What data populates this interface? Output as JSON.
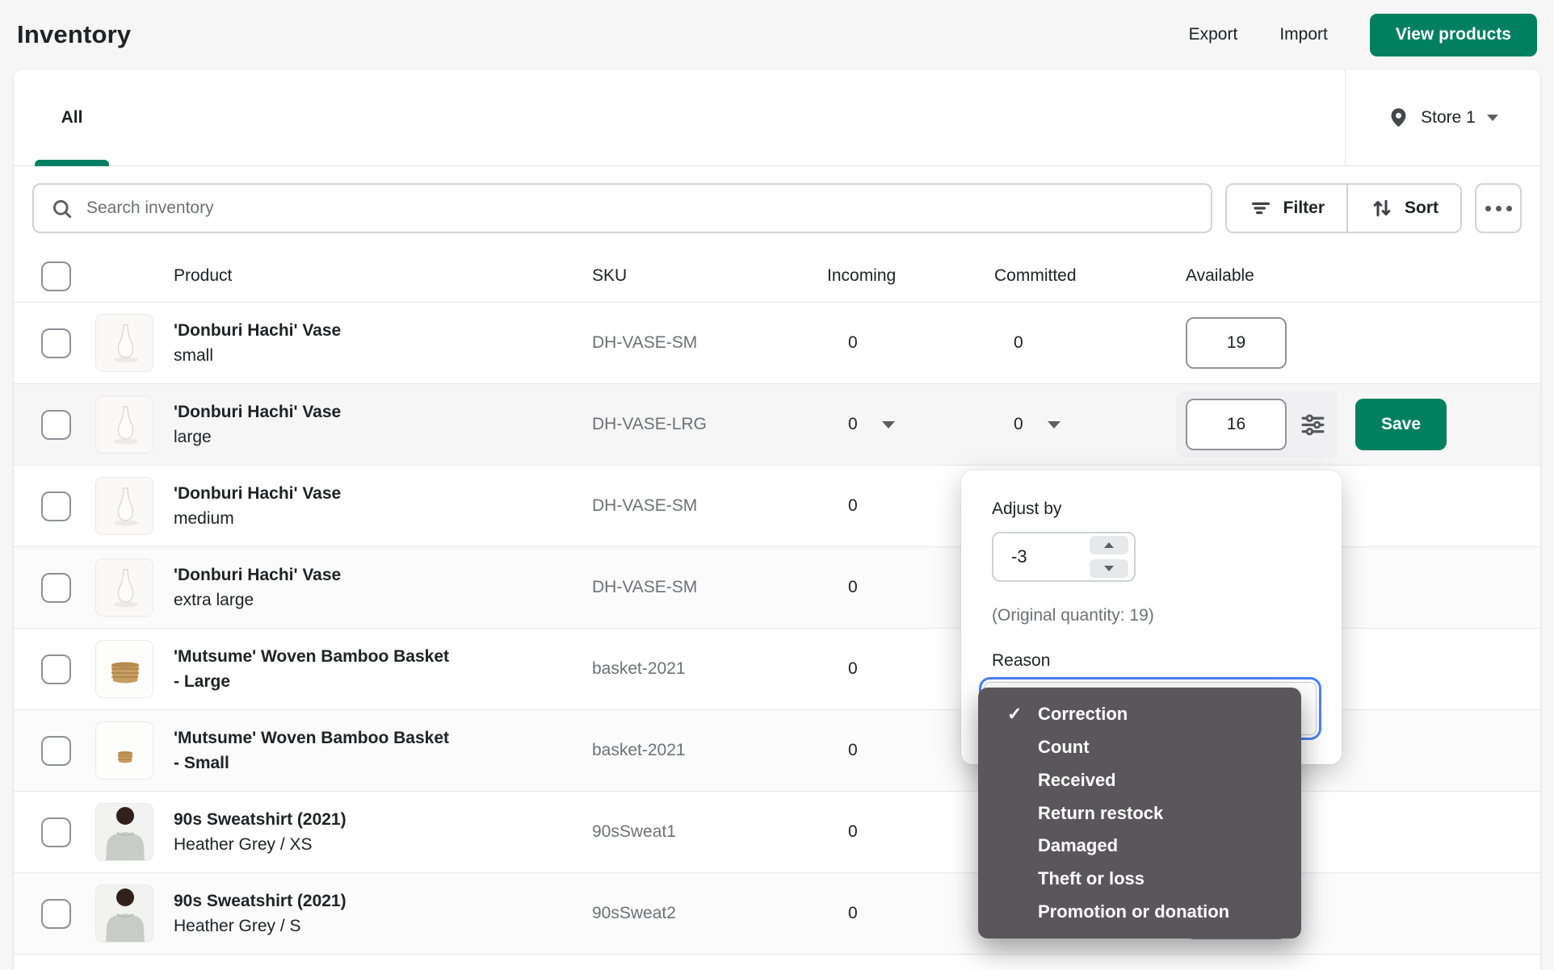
{
  "header": {
    "title": "Inventory",
    "export_label": "Export",
    "import_label": "Import",
    "view_products_label": "View products"
  },
  "tabs": {
    "all_label": "All"
  },
  "store": {
    "label": "Store 1",
    "icon": "location-pin"
  },
  "toolbar": {
    "search_placeholder": "Search inventory",
    "filter_label": "Filter",
    "sort_label": "Sort",
    "more_icon": "horizontal-dots"
  },
  "table": {
    "headers": {
      "product": "Product",
      "sku": "SKU",
      "incoming": "Incoming",
      "committed": "Committed",
      "available": "Available"
    },
    "save_label": "Save",
    "rows": [
      {
        "title": "'Donburi Hachi' Vase",
        "variant": "small",
        "sku": "DH-VASE-SM",
        "incoming": "0",
        "committed": "0",
        "available": "19",
        "image": "vase"
      },
      {
        "title": "'Donburi Hachi' Vase",
        "variant": "large",
        "sku": "DH-VASE-LRG",
        "incoming": "0",
        "committed": "0",
        "available": "16",
        "image": "vase"
      },
      {
        "title": "'Donburi Hachi' Vase",
        "variant": "medium",
        "sku": "DH-VASE-SM",
        "incoming": "0",
        "image": "vase"
      },
      {
        "title": "'Donburi Hachi' Vase",
        "variant": "extra large",
        "sku": "DH-VASE-SM",
        "incoming": "0",
        "image": "vase"
      },
      {
        "title": "'Mutsume' Woven Bamboo Basket - Large",
        "variant": "",
        "sku": "basket-2021",
        "incoming": "0",
        "image": "basket-large"
      },
      {
        "title": "'Mutsume' Woven Bamboo Basket - Small",
        "variant": "",
        "sku": "basket-2021",
        "incoming": "0",
        "image": "basket-small"
      },
      {
        "title": "90s Sweatshirt (2021)",
        "variant": "Heather Grey / XS",
        "sku": "90sSweat1",
        "incoming": "0",
        "image": "model"
      },
      {
        "title": "90s Sweatshirt (2021)",
        "variant": "Heather Grey / S",
        "sku": "90sSweat2",
        "incoming": "0",
        "image": "model"
      }
    ]
  },
  "adjust_popover": {
    "adjust_by_label": "Adjust by",
    "adjust_value": "-3",
    "original_quantity_note": "(Original quantity: 19)",
    "reason_label": "Reason"
  },
  "reason_menu": {
    "checkmark": "✓",
    "selected": "Correction",
    "items": [
      "Correction",
      "Count",
      "Received",
      "Return restock",
      "Damaged",
      "Theft or loss",
      "Promotion or donation"
    ]
  },
  "colors": {
    "brand_green": "#008060",
    "focus_blue": "#4b82f6",
    "menu_background": "#5a575c"
  }
}
